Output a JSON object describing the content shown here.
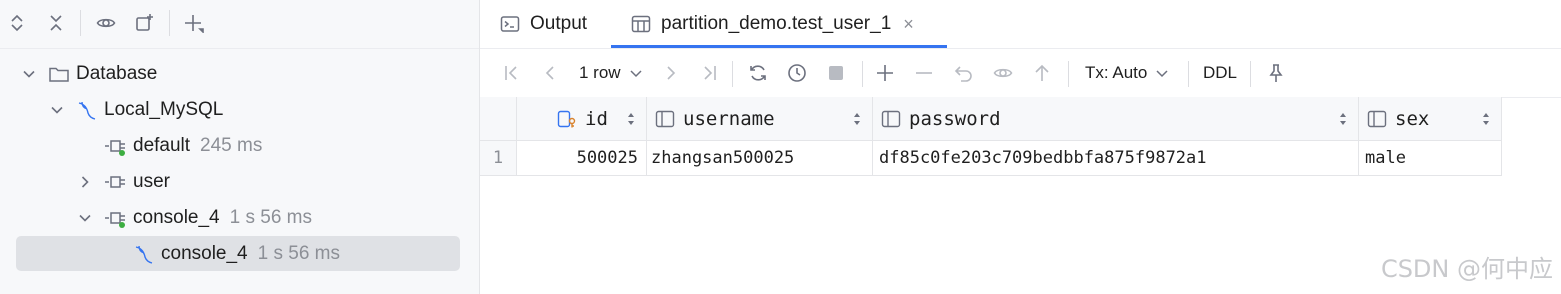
{
  "left_panel": {
    "toolbar": {
      "items": [
        "expand-all-icon",
        "collapse-all-icon",
        "view-options-icon",
        "new-query-console-icon",
        "add-icon"
      ]
    },
    "tree": [
      {
        "label": "Database",
        "meta": ""
      },
      {
        "label": "Local_MySQL",
        "meta": ""
      },
      {
        "label": "default",
        "meta": "245 ms"
      },
      {
        "label": "user",
        "meta": ""
      },
      {
        "label": "console_4",
        "meta": "1 s 56 ms"
      },
      {
        "label": "console_4",
        "meta": "1 s 56 ms"
      }
    ]
  },
  "tabs": [
    {
      "label": "Output",
      "icon": "console-icon"
    },
    {
      "label": "partition_demo.test_user_1",
      "icon": "table-icon",
      "close": "×"
    }
  ],
  "data_toolbar": {
    "row_count": "1 row",
    "tx_mode": "Tx: Auto",
    "ddl": "DDL"
  },
  "table": {
    "columns": [
      {
        "name": "id"
      },
      {
        "name": "username"
      },
      {
        "name": "password"
      },
      {
        "name": "sex"
      }
    ],
    "rows": [
      {
        "num": "1",
        "cells": [
          "500025",
          "zhangsan500025",
          "df85c0fe203c709bedbbfa875f9872a1",
          "male"
        ]
      }
    ]
  },
  "watermark": "CSDN @何中应",
  "colors": {
    "accent": "#3574f0",
    "selection": "#dfe1e5",
    "connected": "#3dae41"
  }
}
